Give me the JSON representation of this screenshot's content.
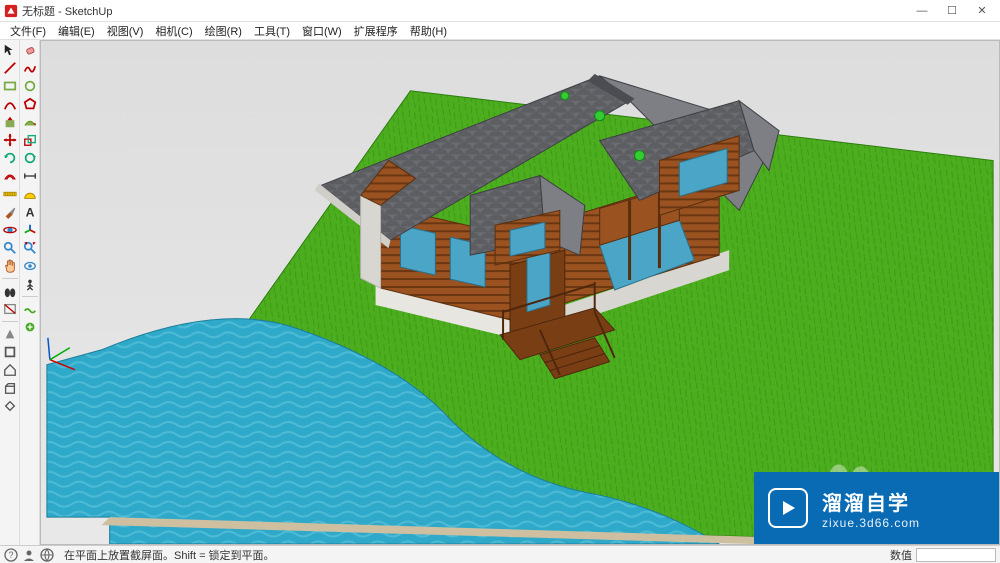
{
  "titlebar": {
    "title": "无标题 - SketchUp"
  },
  "menu": {
    "items": [
      "文件(F)",
      "编辑(E)",
      "视图(V)",
      "相机(C)",
      "绘图(R)",
      "工具(T)",
      "窗口(W)",
      "扩展程序",
      "帮助(H)"
    ]
  },
  "toolbar_left1": {
    "tools": [
      "select",
      "eraser",
      "line",
      "arc",
      "rectangle",
      "circle",
      "freehand",
      "push-pull",
      "move",
      "rotate",
      "scale",
      "offset",
      "tape",
      "protractor",
      "text",
      "paint",
      "orbit",
      "pan"
    ]
  },
  "toolbar_left2": {
    "tools": [
      "make-component",
      "paint-bucket",
      "pencil",
      "arc-2pt",
      "shape-rect",
      "shape-polygon",
      "follow-me",
      "push-pull-2",
      "move-2",
      "rotate-2",
      "scale-2",
      "offset-2",
      "tape-2",
      "dimension",
      "axes",
      "section",
      "zoom",
      "zoom-extents",
      "walk",
      "look",
      "position-camera",
      "sandbox-1",
      "sandbox-2"
    ]
  },
  "statusbar": {
    "message": "在平面上放置截屏面。Shift = 锁定到平面。",
    "value_label": "数值"
  },
  "watermark": {
    "title": "溜溜自学",
    "url": "zixue.3d66.com"
  },
  "colors": {
    "grass": "#4cae1e",
    "grass_dark": "#3d9a15",
    "water": "#2fa9c9",
    "water_light": "#5cc3dc",
    "roof": "#5d5e62",
    "roof_light": "#7e7f84",
    "wall_wood": "#9a5220",
    "wall_wood_dark": "#6b3712",
    "trim": "#e8e6e0",
    "window": "#4aa5c6",
    "deck": "#7a3e14",
    "sky": "#dedede",
    "brand": "#0a6bb5"
  }
}
